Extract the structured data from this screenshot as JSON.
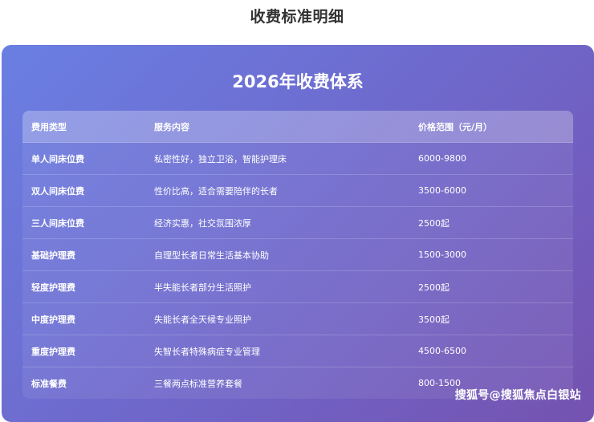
{
  "page": {
    "heading": "收费标准明细"
  },
  "panel": {
    "title": "2026年收费体系"
  },
  "table": {
    "headers": {
      "type": "费用类型",
      "content": "服务内容",
      "price": "价格范围（元/月）"
    },
    "rows": [
      {
        "type": "单人间床位费",
        "content": "私密性好，独立卫浴，智能护理床",
        "price": "6000-9800"
      },
      {
        "type": "双人间床位费",
        "content": "性价比高，适合需要陪伴的长者",
        "price": "3500-6000"
      },
      {
        "type": "三人间床位费",
        "content": "经济实惠，社交氛围浓厚",
        "price": "2500起"
      },
      {
        "type": "基础护理费",
        "content": "自理型长者日常生活基本协助",
        "price": "1500-3000"
      },
      {
        "type": "轻度护理费",
        "content": "半失能长者部分生活照护",
        "price": "2500起"
      },
      {
        "type": "中度护理费",
        "content": "失能长者全天候专业照护",
        "price": "3500起"
      },
      {
        "type": "重度护理费",
        "content": "失智长者特殊病症专业管理",
        "price": "4500-6500"
      },
      {
        "type": "标准餐费",
        "content": "三餐两点标准营养套餐",
        "price": "800-1500"
      }
    ]
  },
  "watermark": "搜狐号@搜狐焦点白银站",
  "colors": {
    "heading": "#333333",
    "panel_gradient_start": "#6a7fe3",
    "panel_gradient_end": "#7552b0",
    "text": "#ffffff"
  }
}
